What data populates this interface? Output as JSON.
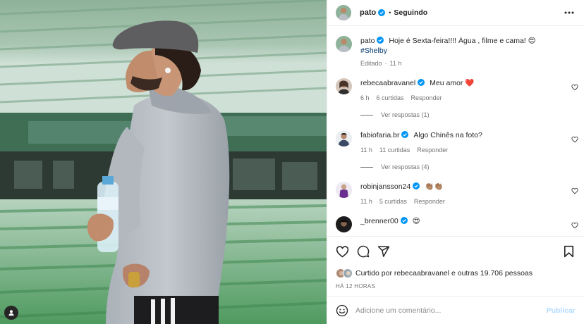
{
  "post_header": {
    "username": "pato",
    "separator": "•",
    "follow_status": "Seguindo"
  },
  "caption": {
    "username": "pato",
    "text": "Hoje é Sexta-feira!!!! Água , filme e cama! 😍",
    "hashtag": "#Shelby",
    "edited": "Editado",
    "time": "11 h"
  },
  "comments": [
    {
      "username": "rebecaabravanel",
      "verified": true,
      "text": "Meu amor ❤️",
      "time": "6 h",
      "likes": "6 curtidas",
      "reply": "Responder",
      "view_replies": "Ver respostas (1)"
    },
    {
      "username": "fabiofaria.br",
      "verified": true,
      "text": "Algo Chinês na foto?",
      "time": "11 h",
      "likes": "11 curtidas",
      "reply": "Responder",
      "view_replies": "Ver respostas (4)"
    },
    {
      "username": "robinjansson24",
      "verified": true,
      "text": "👏🏽👏🏽",
      "time": "11 h",
      "likes": "5 curtidas",
      "reply": "Responder"
    },
    {
      "username": "_brenner00",
      "verified": true,
      "text": "😍"
    }
  ],
  "likes_summary": "Curtido por rebecaabravanel e outras 19.706 pessoas",
  "timestamp": "HÁ 12 HORAS",
  "comment_box": {
    "placeholder": "Adicione um comentário...",
    "publish_label": "Publicar"
  },
  "icons": {
    "like": "heart-icon",
    "comment": "comment-icon",
    "share": "send-icon",
    "save": "bookmark-icon",
    "more": "more-options-icon",
    "emoji": "emoji-icon",
    "tag": "user-tag-icon",
    "verified": "verified-badge-icon"
  },
  "colors": {
    "verified_blue": "#0095f6",
    "publish_disabled": "#b3dbff",
    "hashtag": "#00376b",
    "meta_gray": "#737373"
  }
}
